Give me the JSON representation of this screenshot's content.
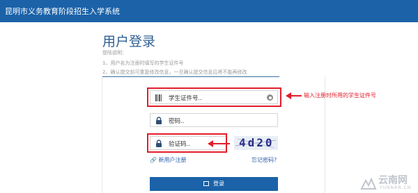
{
  "header": {
    "title": "昆明市义务教育阶段招生入学系统"
  },
  "login": {
    "title": "用户登录",
    "note_title": "登陆说明：",
    "notes": [
      "1、用户名为注册时填写的学生证件号",
      "2、确认提交前可重复修改信息，一旦确认提交信息后将不能再修改"
    ],
    "id_placeholder": "学生证件号..",
    "password_placeholder": "密码..",
    "captcha_placeholder": "验证码..",
    "captcha_code": "4d20",
    "register_link": "新用户注册",
    "forgot_link": "忘记密码?",
    "submit_label": "登录"
  },
  "annotation": {
    "text": "输入注册时所用的学生证件号"
  },
  "watermark": {
    "main": "云南网",
    "sub": "YUNNAN.CN"
  },
  "colors": {
    "header": "#1b62a8",
    "highlight": "#e21d2a",
    "link": "#2a5ca8"
  },
  "icons": {
    "id_field": "id-card-icon",
    "password_field": "lock-icon",
    "captcha_field": "lock-icon",
    "clear": "clear-icon",
    "register": "link-icon",
    "submit": "login-icon"
  }
}
